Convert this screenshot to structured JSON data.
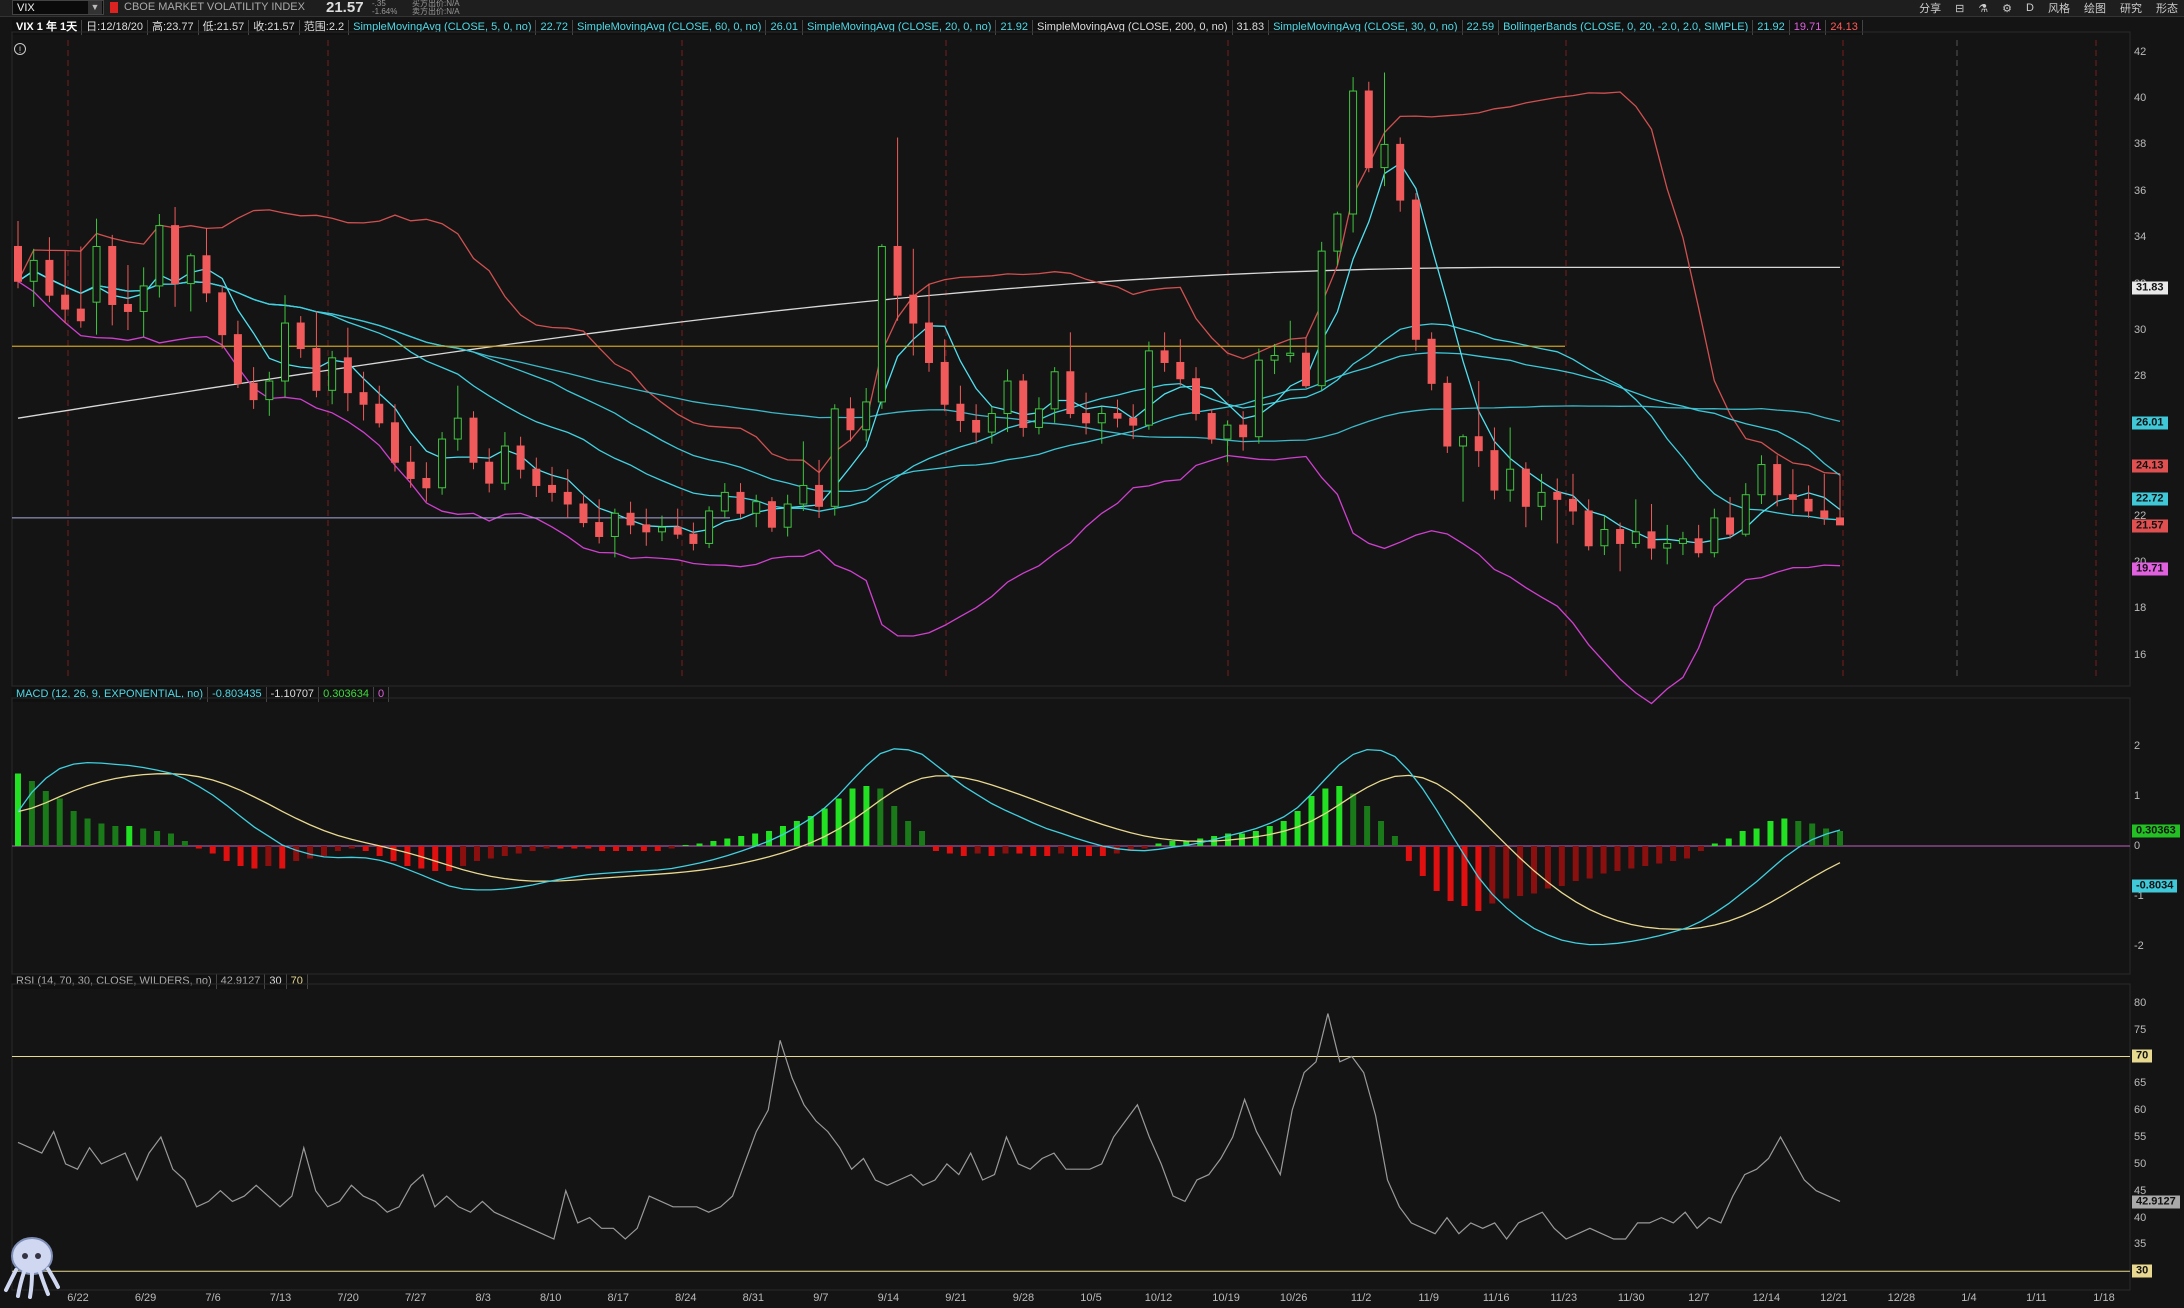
{
  "header": {
    "symbol": "VIX",
    "company": "CBOE MARKET VOLATILITY INDEX",
    "last": "21.57",
    "change_top": "-.35",
    "change_pct": "-1.64%",
    "bid": "买方出价:N/A",
    "ask": "卖方出价:N/A",
    "tools": [
      "分享",
      "⊟",
      "⚗",
      "⚙",
      "D",
      "风格",
      "绘图",
      "研究",
      "形态"
    ]
  },
  "study_bar": {
    "title": "VIX 1 年 1天",
    "date": "日:12/18/20",
    "high": "高:23.77",
    "low": "低:21.57",
    "close": "收:21.57",
    "range": "范围:2.2",
    "sma5": "SimpleMovingAvg (CLOSE, 5, 0, no)",
    "sma5_val": "22.72",
    "sma60": "SimpleMovingAvg (CLOSE, 60, 0, no)",
    "sma60_val": "26.01",
    "sma20": "SimpleMovingAvg (CLOSE, 20, 0, no)",
    "sma20_val": "21.92",
    "sma200": "SimpleMovingAvg (CLOSE, 200, 0, no)",
    "sma200_val": "31.83",
    "sma30": "SimpleMovingAvg (CLOSE, 30, 0, no)",
    "sma30_val": "22.59",
    "bb": "BollingerBands (CLOSE, 0, 20, -2.0, 2.0, SIMPLE)",
    "bb_mid": "21.92",
    "bb_low": "19.71",
    "bb_up": "24.13"
  },
  "macd_label": {
    "name": "MACD (12, 26, 9, EXPONENTIAL, no)",
    "value": "-0.803435",
    "avg": "-1.10707",
    "diff": "0.303634",
    "zero": "0"
  },
  "rsi_label": {
    "name": "RSI (14, 70, 30, CLOSE, WILDERS, no)",
    "value": "42.9127",
    "oversold": "30",
    "overbought": "70"
  },
  "price_axis": {
    "ticks": [
      "42",
      "40",
      "38",
      "36",
      "34",
      "32",
      "30",
      "28",
      "26",
      "24",
      "22",
      "20",
      "18",
      "16"
    ],
    "tags": [
      {
        "text": "31.83",
        "value": 31.83,
        "bg": "#e8e8e8"
      },
      {
        "text": "26.01",
        "value": 26.01,
        "bg": "#3ec8d8"
      },
      {
        "text": "24.13",
        "value": 24.13,
        "bg": "#e05050"
      },
      {
        "text": "22.72",
        "value": 22.72,
        "bg": "#3ec8d8"
      },
      {
        "text": "21.57",
        "value": 21.57,
        "bg": "#e05050"
      },
      {
        "text": "19.71",
        "value": 19.71,
        "bg": "#e060e0"
      }
    ]
  },
  "macd_axis": {
    "ticks": [
      "2",
      "1",
      "0",
      "-1",
      "-2"
    ],
    "tags": [
      {
        "text": "0.30363",
        "value": 0.30363,
        "bg": "#22c022"
      },
      {
        "text": "-0.8034",
        "value": -0.8034,
        "bg": "#3ec8d8"
      }
    ]
  },
  "rsi_axis": {
    "ticks": [
      "80",
      "75",
      "70",
      "65",
      "60",
      "55",
      "50",
      "45",
      "40",
      "35",
      "30"
    ],
    "tags": [
      {
        "text": "70",
        "value": 70,
        "bg": "#e8d890"
      },
      {
        "text": "42.9127",
        "value": 42.9127,
        "bg": "#aaaaaa"
      },
      {
        "text": "30",
        "value": 30,
        "bg": "#e8d890"
      }
    ]
  },
  "x_axis": [
    "6/22",
    "6/29",
    "7/6",
    "7/13",
    "7/20",
    "7/27",
    "8/3",
    "8/10",
    "8/17",
    "8/24",
    "8/31",
    "9/7",
    "9/14",
    "9/21",
    "9/28",
    "10/5",
    "10/12",
    "10/19",
    "10/26",
    "11/2",
    "11/9",
    "11/16",
    "11/23",
    "11/30",
    "12/7",
    "12/14",
    "12/21",
    "12/28",
    "1/4",
    "1/11",
    "1/18"
  ],
  "chart_data": [
    {
      "type": "candlestick",
      "title": "VIX 1 年 1天",
      "ylim": [
        15,
        42.5
      ],
      "ohlc": [
        [
          33.6,
          34.7,
          31.8,
          32.1
        ],
        [
          32.1,
          33.5,
          31.0,
          33.0
        ],
        [
          33.0,
          34.0,
          31.2,
          31.5
        ],
        [
          31.5,
          33.4,
          30.3,
          30.9
        ],
        [
          30.9,
          33.6,
          30.1,
          30.4
        ],
        [
          31.2,
          34.8,
          29.8,
          33.6
        ],
        [
          33.6,
          34.1,
          30.2,
          31.1
        ],
        [
          31.1,
          32.8,
          30.0,
          30.8
        ],
        [
          30.8,
          32.7,
          29.7,
          31.9
        ],
        [
          31.9,
          35.0,
          31.4,
          34.5
        ],
        [
          34.5,
          35.3,
          31.0,
          32.0
        ],
        [
          32.0,
          33.3,
          30.8,
          33.2
        ],
        [
          33.2,
          34.4,
          31.2,
          31.6
        ],
        [
          31.6,
          31.9,
          29.2,
          29.8
        ],
        [
          29.8,
          30.4,
          27.5,
          27.7
        ],
        [
          27.7,
          28.4,
          26.6,
          27.0
        ],
        [
          27.0,
          28.2,
          26.3,
          27.8
        ],
        [
          27.8,
          31.5,
          27.1,
          30.3
        ],
        [
          30.3,
          30.6,
          28.8,
          29.2
        ],
        [
          29.2,
          30.8,
          27.1,
          27.4
        ],
        [
          27.4,
          29.1,
          26.8,
          28.8
        ],
        [
          28.8,
          30.1,
          26.5,
          27.3
        ],
        [
          27.3,
          28.2,
          26.1,
          26.8
        ],
        [
          26.8,
          27.6,
          25.8,
          26.0
        ],
        [
          26.0,
          26.8,
          23.9,
          24.3
        ],
        [
          24.3,
          25.0,
          23.2,
          23.6
        ],
        [
          23.6,
          24.3,
          22.6,
          23.2
        ],
        [
          23.2,
          25.6,
          22.9,
          25.3
        ],
        [
          25.3,
          27.6,
          24.8,
          26.2
        ],
        [
          26.2,
          26.5,
          24.0,
          24.3
        ],
        [
          24.3,
          24.9,
          23.0,
          23.4
        ],
        [
          23.4,
          25.6,
          23.1,
          25.0
        ],
        [
          25.0,
          25.4,
          23.6,
          24.0
        ],
        [
          24.0,
          24.5,
          22.8,
          23.3
        ],
        [
          23.3,
          24.1,
          22.6,
          23.0
        ],
        [
          23.0,
          24.0,
          21.9,
          22.5
        ],
        [
          22.5,
          22.9,
          21.5,
          21.7
        ],
        [
          21.7,
          22.7,
          20.8,
          21.1
        ],
        [
          21.1,
          22.3,
          20.2,
          22.1
        ],
        [
          22.1,
          22.6,
          21.2,
          21.6
        ],
        [
          21.6,
          22.3,
          20.7,
          21.3
        ],
        [
          21.3,
          22.0,
          20.9,
          21.5
        ],
        [
          21.5,
          22.3,
          21.0,
          21.2
        ],
        [
          21.2,
          21.7,
          20.5,
          20.8
        ],
        [
          20.8,
          22.4,
          20.6,
          22.2
        ],
        [
          22.2,
          23.4,
          21.9,
          23.0
        ],
        [
          23.0,
          23.4,
          21.9,
          22.1
        ],
        [
          22.1,
          22.9,
          21.5,
          22.6
        ],
        [
          22.6,
          22.8,
          21.3,
          21.5
        ],
        [
          21.5,
          22.9,
          21.1,
          22.5
        ],
        [
          22.5,
          25.2,
          22.2,
          23.3
        ],
        [
          23.3,
          24.4,
          21.9,
          22.4
        ],
        [
          22.4,
          26.8,
          22.0,
          26.6
        ],
        [
          26.6,
          27.1,
          25.2,
          25.7
        ],
        [
          25.7,
          27.5,
          25.2,
          26.9
        ],
        [
          26.9,
          33.7,
          26.6,
          33.6
        ],
        [
          33.6,
          38.3,
          30.4,
          31.5
        ],
        [
          31.5,
          33.5,
          28.9,
          30.3
        ],
        [
          30.3,
          32.0,
          28.2,
          28.6
        ],
        [
          28.6,
          29.6,
          26.5,
          26.8
        ],
        [
          26.8,
          27.6,
          25.6,
          26.1
        ],
        [
          26.1,
          26.8,
          25.1,
          25.6
        ],
        [
          25.6,
          26.7,
          25.1,
          26.4
        ],
        [
          26.4,
          28.3,
          25.6,
          27.8
        ],
        [
          27.8,
          28.1,
          25.4,
          25.8
        ],
        [
          25.8,
          27.1,
          25.5,
          26.6
        ],
        [
          26.6,
          28.4,
          26.0,
          28.2
        ],
        [
          28.2,
          29.9,
          26.2,
          26.4
        ],
        [
          26.4,
          27.3,
          25.5,
          26.0
        ],
        [
          26.0,
          26.7,
          25.1,
          26.4
        ],
        [
          26.4,
          27.0,
          25.8,
          26.2
        ],
        [
          26.2,
          26.8,
          25.3,
          25.9
        ],
        [
          25.9,
          29.5,
          25.7,
          29.1
        ],
        [
          29.1,
          29.9,
          28.2,
          28.6
        ],
        [
          28.6,
          29.6,
          27.6,
          27.9
        ],
        [
          27.9,
          28.4,
          26.1,
          26.4
        ],
        [
          26.4,
          26.6,
          25.1,
          25.3
        ],
        [
          25.3,
          26.1,
          24.3,
          25.9
        ],
        [
          25.9,
          26.5,
          24.8,
          25.4
        ],
        [
          25.4,
          29.2,
          25.1,
          28.7
        ],
        [
          28.7,
          29.4,
          28.1,
          28.9
        ],
        [
          28.9,
          30.4,
          28.6,
          29.0
        ],
        [
          29.0,
          29.7,
          27.5,
          27.6
        ],
        [
          27.6,
          33.8,
          27.4,
          33.4
        ],
        [
          33.4,
          35.1,
          32.8,
          35.0
        ],
        [
          35.0,
          40.9,
          34.2,
          40.3
        ],
        [
          40.3,
          40.7,
          36.8,
          37.0
        ],
        [
          37.0,
          41.1,
          36.2,
          38.0
        ],
        [
          38.0,
          38.3,
          35.1,
          35.6
        ],
        [
          35.6,
          35.9,
          29.1,
          29.6
        ],
        [
          29.6,
          29.9,
          27.4,
          27.7
        ],
        [
          27.7,
          28.0,
          24.7,
          25.0
        ],
        [
          25.0,
          25.5,
          22.6,
          25.4
        ],
        [
          25.4,
          27.8,
          24.1,
          24.8
        ],
        [
          24.8,
          25.8,
          22.7,
          23.1
        ],
        [
          23.1,
          25.8,
          22.6,
          24.0
        ],
        [
          24.0,
          24.3,
          21.5,
          22.4
        ],
        [
          22.4,
          23.8,
          21.8,
          23.0
        ],
        [
          23.0,
          23.6,
          20.8,
          22.7
        ],
        [
          22.7,
          23.8,
          21.6,
          22.2
        ],
        [
          22.2,
          22.7,
          20.5,
          20.7
        ],
        [
          20.7,
          22.0,
          20.3,
          21.4
        ],
        [
          21.4,
          21.7,
          19.6,
          20.8
        ],
        [
          20.8,
          22.7,
          20.6,
          21.3
        ],
        [
          21.3,
          22.5,
          20.1,
          20.6
        ],
        [
          20.6,
          21.6,
          19.9,
          20.8
        ],
        [
          20.8,
          21.3,
          20.3,
          21.0
        ],
        [
          21.0,
          21.6,
          20.2,
          20.4
        ],
        [
          20.4,
          22.3,
          20.2,
          21.9
        ],
        [
          21.9,
          22.8,
          21.0,
          21.2
        ],
        [
          21.2,
          23.4,
          21.1,
          22.9
        ],
        [
          22.9,
          24.6,
          22.5,
          24.2
        ],
        [
          24.2,
          24.6,
          22.4,
          22.9
        ],
        [
          22.9,
          24.0,
          22.1,
          22.7
        ],
        [
          22.7,
          23.3,
          21.9,
          22.2
        ],
        [
          22.2,
          23.8,
          21.6,
          21.9
        ],
        [
          21.9,
          23.8,
          21.6,
          21.6
        ]
      ],
      "series": [
        {
          "name": "SimpleMovingAvg (CLOSE, 5, 0, no)",
          "value": 22.72
        },
        {
          "name": "SimpleMovingAvg (CLOSE, 60, 0, no)",
          "value": 26.01
        },
        {
          "name": "SimpleMovingAvg (CLOSE, 20, 0, no)",
          "value": 21.92
        },
        {
          "name": "SimpleMovingAvg (CLOSE, 200, 0, no)",
          "value": 31.83
        },
        {
          "name": "SimpleMovingAvg (CLOSE, 30, 0, no)",
          "value": 22.59
        },
        {
          "name": "BollingerBands (CLOSE, 0, 20, -2.0, 2.0, SIMPLE)",
          "values": {
            "mid": 21.92,
            "lower": 19.71,
            "upper": 24.13
          }
        }
      ],
      "grid": false
    },
    {
      "type": "bar",
      "title": "MACD (12, 26, 9, EXPONENTIAL, no)",
      "ylim": [
        -2.4,
        2.8
      ],
      "hist": [
        1.45,
        1.3,
        1.1,
        0.95,
        0.7,
        0.55,
        0.45,
        0.4,
        0.4,
        0.35,
        0.3,
        0.25,
        0.1,
        -0.05,
        -0.15,
        -0.3,
        -0.4,
        -0.45,
        -0.4,
        -0.45,
        -0.3,
        -0.25,
        -0.2,
        -0.1,
        -0.05,
        -0.1,
        -0.2,
        -0.3,
        -0.4,
        -0.45,
        -0.5,
        -0.5,
        -0.4,
        -0.3,
        -0.25,
        -0.2,
        -0.15,
        -0.1,
        -0.05,
        -0.05,
        -0.05,
        -0.05,
        -0.1,
        -0.1,
        -0.1,
        -0.1,
        -0.1,
        -0.05,
        0.02,
        0.05,
        0.1,
        0.15,
        0.2,
        0.25,
        0.3,
        0.4,
        0.5,
        0.6,
        0.75,
        0.95,
        1.15,
        1.2,
        1.15,
        0.8,
        0.5,
        0.3,
        -0.1,
        -0.15,
        -0.2,
        -0.15,
        -0.2,
        -0.15,
        -0.15,
        -0.2,
        -0.2,
        -0.15,
        -0.2,
        -0.2,
        -0.2,
        -0.15,
        -0.1,
        -0.05,
        0.05,
        0.1,
        0.1,
        0.15,
        0.2,
        0.25,
        0.25,
        0.3,
        0.4,
        0.5,
        0.7,
        1.0,
        1.15,
        1.2,
        1.05,
        0.8,
        0.5,
        0.2,
        -0.3,
        -0.6,
        -0.9,
        -1.1,
        -1.2,
        -1.3,
        -1.15,
        -1.05,
        -1.0,
        -0.95,
        -0.85,
        -0.8,
        -0.7,
        -0.65,
        -0.55,
        -0.5,
        -0.45,
        -0.4,
        -0.35,
        -0.3,
        -0.25,
        -0.1,
        0.05,
        0.15,
        0.3,
        0.35,
        0.5,
        0.55,
        0.5,
        0.45,
        0.35,
        0.3
      ]
    },
    {
      "type": "line",
      "title": "RSI (14, 70, 30, CLOSE, WILDERS, no)",
      "ylim": [
        28,
        82
      ],
      "values": [
        54,
        53,
        52,
        56,
        50,
        49,
        53,
        50,
        51,
        52,
        47,
        52,
        55,
        49,
        47,
        42,
        43,
        45,
        43,
        44,
        46,
        44,
        42,
        44,
        53,
        45,
        42,
        43,
        46,
        44,
        43,
        41,
        42,
        46,
        48,
        42,
        44,
        42,
        41,
        43,
        41,
        40,
        39,
        38,
        37,
        36,
        45,
        39,
        40,
        38,
        38,
        36,
        38,
        44,
        43,
        42,
        42,
        42,
        41,
        42,
        44,
        50,
        56,
        60,
        73,
        66,
        61,
        58,
        56,
        53,
        49,
        51,
        47,
        46,
        47,
        48,
        46,
        47,
        50,
        48,
        52,
        47,
        48,
        55,
        50,
        49,
        51,
        52,
        49,
        49,
        49,
        50,
        55,
        58,
        61,
        55,
        50,
        44,
        43,
        47,
        48,
        51,
        55,
        62,
        56,
        52,
        48,
        60,
        67,
        69,
        78,
        69,
        70,
        67,
        59,
        47,
        42,
        39,
        38,
        37,
        40,
        37,
        39,
        38,
        39,
        36,
        39,
        40,
        41,
        38,
        36,
        37,
        38,
        37,
        36,
        36,
        39,
        39,
        40,
        39,
        41,
        38,
        40,
        39,
        44,
        48,
        49,
        51,
        55,
        51,
        47,
        45,
        44,
        43
      ]
    }
  ]
}
